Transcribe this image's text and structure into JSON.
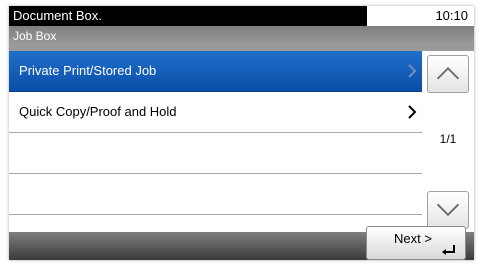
{
  "status": {
    "title": "Document Box.",
    "time": "10:10"
  },
  "header": {
    "title": "Job Box"
  },
  "list": {
    "items": [
      {
        "label": "Private Print/Stored Job",
        "selected": true
      },
      {
        "label": "Quick Copy/Proof and Hold",
        "selected": false
      },
      {
        "label": "",
        "selected": false
      },
      {
        "label": "",
        "selected": false
      }
    ]
  },
  "pager": {
    "page": "1/1"
  },
  "footer": {
    "next_label": "Next >"
  },
  "colors": {
    "selected_row": "#1565c0",
    "status_bar": "#000000",
    "header_bar": "#8c8c8c"
  },
  "icons": {
    "row_chevron": "chevron-right-icon",
    "scroll_up": "chevron-up-icon",
    "scroll_down": "chevron-down-icon",
    "next_enter": "enter-arrow-icon"
  }
}
